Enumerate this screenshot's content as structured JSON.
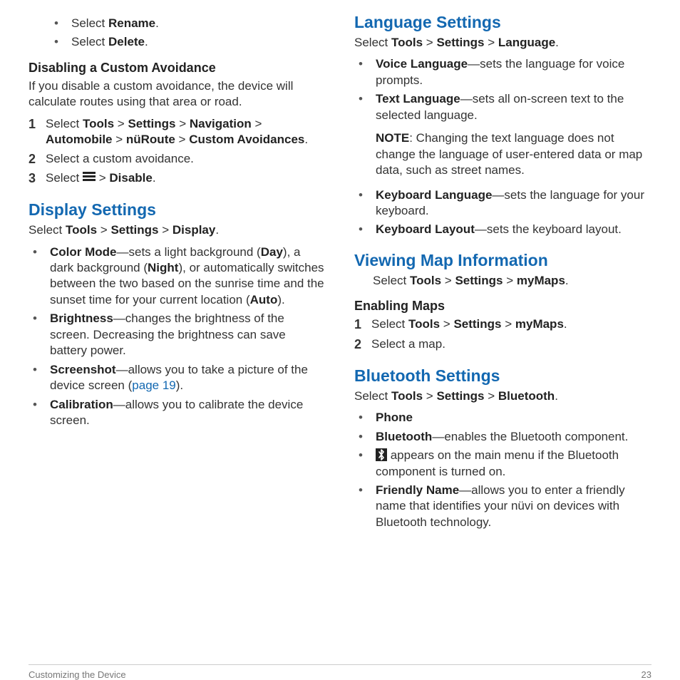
{
  "left": {
    "topBullets": [
      {
        "text": "Select ",
        "bold": "Rename",
        "suffix": "."
      },
      {
        "text": "Select ",
        "bold": "Delete",
        "suffix": "."
      }
    ],
    "disAvoid": {
      "heading": "Disabling a Custom Avoidance",
      "intro": "If you disable a custom avoidance, the device will calculate routes using that area or road.",
      "steps": [
        {
          "mk": "1",
          "html": "Select <b>Tools</b> > <b>Settings</b> > <b>Navigation</b> > <b>Automobile</b> > <b>nüRoute</b> > <b>Custom Avoidances</b>."
        },
        {
          "mk": "2",
          "html": "Select a custom avoidance."
        },
        {
          "mk": "3",
          "html": "Select {MENU} > <b>Disable</b>."
        }
      ]
    },
    "display": {
      "heading": "Display Settings",
      "intro": "Select <b>Tools</b> > <b>Settings</b> > <b>Display</b>.",
      "items": [
        "<b>Color Mode</b>—sets a light background (<b>Day</b>), a dark background (<b>Night</b>), or automatically switches between the two based on the sunrise time and the sunset time for your current location (<b>Auto</b>).",
        "<b>Brightness</b>—changes the brightness of the screen. Decreasing the brightness can save battery power.",
        "<b>Screenshot</b>—allows you to take a picture of the device screen (<a class=\"pg\" href=\"#\">page 19</a>).",
        "<b>Calibration</b>—allows you to calibrate the device screen."
      ]
    }
  },
  "right": {
    "lang": {
      "heading": "Language Settings",
      "intro": "Select <b>Tools</b> > <b>Settings</b> > <b>Language</b>.",
      "items": [
        {
          "main": "<b>Voice Language</b>—sets the language for voice prompts."
        },
        {
          "main": "<b>Text Language</b>—sets all on-screen text to the selected language.",
          "note": "<b>NOTE</b>: Changing the text language does not change the language of user-entered data or map data, such as street names."
        },
        {
          "main": "<b>Keyboard Language</b>—sets the language for your keyboard."
        },
        {
          "main": "<b>Keyboard Layout</b>—sets the keyboard layout."
        }
      ]
    },
    "map": {
      "heading": "Viewing Map Information",
      "intro": "Select <b>Tools</b> > <b>Settings</b> > <b>myMaps</b>.",
      "sub": "Enabling Maps",
      "steps": [
        {
          "mk": "1",
          "html": "Select <b>Tools</b> > <b>Settings</b> > <b>myMaps</b>."
        },
        {
          "mk": "2",
          "html": "Select a map."
        }
      ]
    },
    "bt": {
      "heading": "Bluetooth Settings",
      "intro": "Select <b>Tools</b> > <b>Settings</b> > <b>Bluetooth</b>.",
      "items": [
        "<b>Phone</b>",
        "<b>Bluetooth</b>—enables the Bluetooth component.",
        "{BT} appears on the main menu if the Bluetooth component is turned on.",
        "<b>Friendly Name</b>—allows you to enter a friendly name that identifies your nüvi on devices with Bluetooth technology."
      ]
    }
  },
  "footer": {
    "left": "Customizing the Device",
    "right": "23"
  }
}
